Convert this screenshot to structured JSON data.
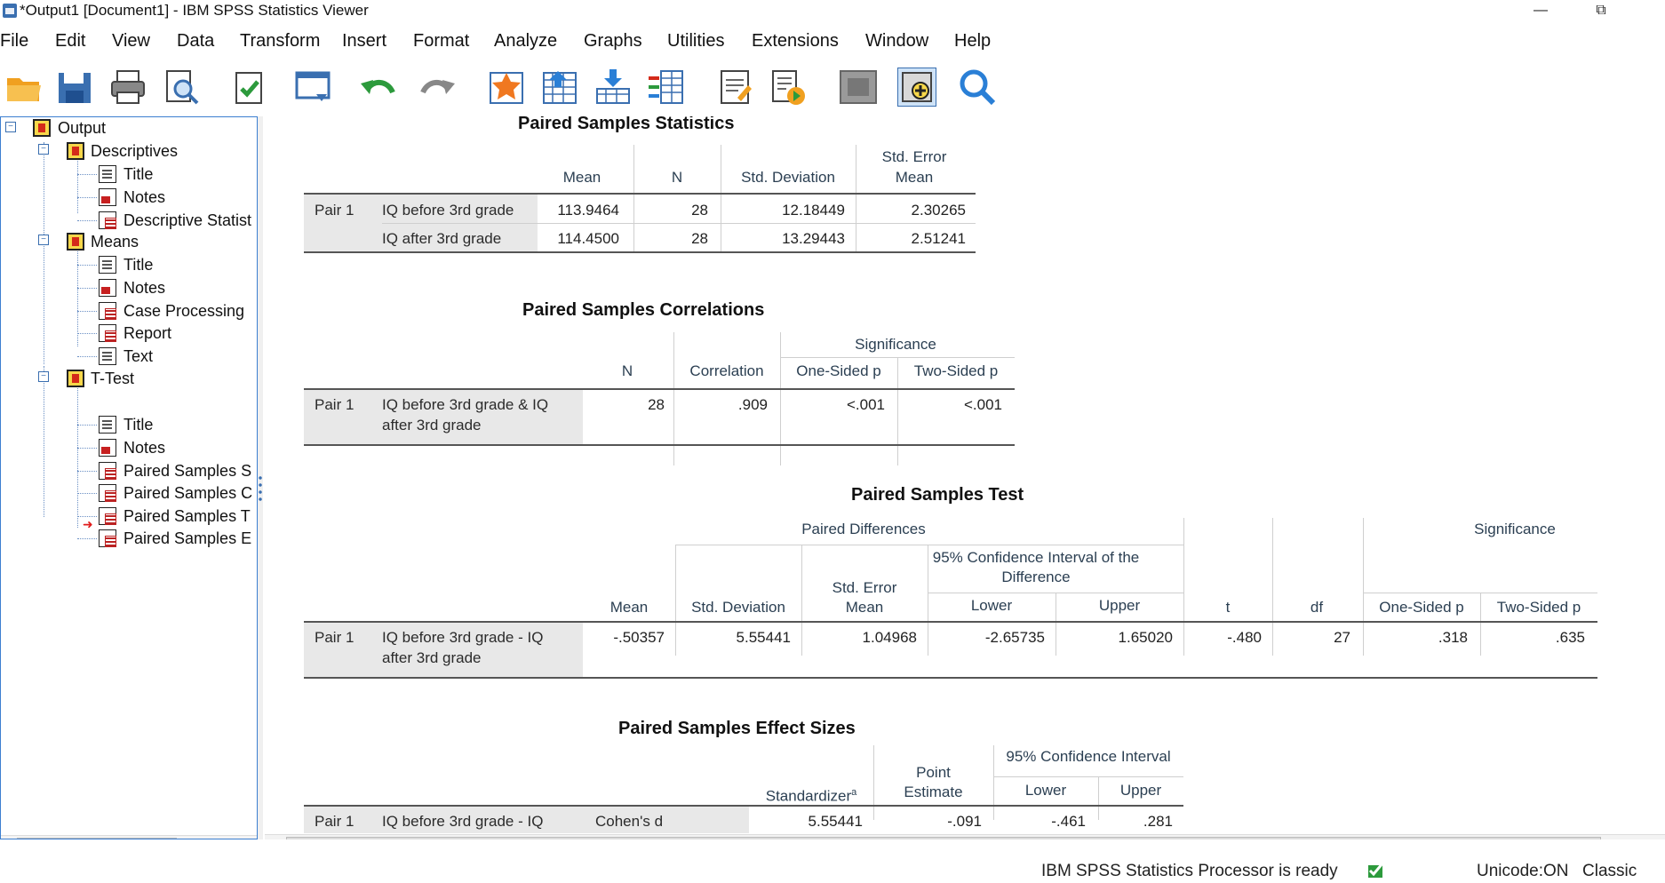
{
  "window": {
    "title": "*Output1 [Document1] - IBM SPSS Statistics Viewer",
    "minimize": "—",
    "restore": "⧉"
  },
  "menu": [
    "File",
    "Edit",
    "View",
    "Data",
    "Transform",
    "Insert",
    "Format",
    "Analyze",
    "Graphs",
    "Utilities",
    "Extensions",
    "Window",
    "Help"
  ],
  "toolbar": [
    "open-icon",
    "save-icon",
    "print-icon",
    "print-preview-icon",
    "export-icon",
    "recall-dialog-icon",
    "undo-icon",
    "redo-icon",
    "goto-case-icon",
    "goto-variable-icon",
    "variables-icon",
    "insert-output-icon",
    "designate-window-icon",
    "run-script-icon",
    "show-pane-icon",
    "add-item-icon",
    "search-icon"
  ],
  "outline": {
    "root": "Output",
    "descriptives": {
      "label": "Descriptives",
      "items": [
        "Title",
        "Notes",
        "Descriptive Statist"
      ]
    },
    "means": {
      "label": "Means",
      "items": [
        "Title",
        "Notes",
        "Case Processing",
        "Report",
        "Text"
      ]
    },
    "ttest": {
      "label": "T-Test",
      "items": [
        "Title",
        "Notes",
        "Paired Samples S",
        "Paired Samples C",
        "Paired Samples T",
        "Paired Samples E"
      ]
    }
  },
  "stats": {
    "title": "Paired Samples Statistics",
    "headers": [
      "Mean",
      "N",
      "Std. Deviation",
      "Std. Error",
      "Mean"
    ],
    "pair": "Pair 1",
    "rows": [
      [
        "IQ before 3rd grade",
        "113.9464",
        "28",
        "12.18449",
        "2.30265"
      ],
      [
        "IQ after 3rd grade",
        "114.4500",
        "28",
        "13.29443",
        "2.51241"
      ]
    ]
  },
  "corr": {
    "title": "Paired Samples Correlations",
    "significance": "Significance",
    "headers": [
      "N",
      "Correlation",
      "One-Sided p",
      "Two-Sided p"
    ],
    "pair": "Pair 1",
    "label1": "IQ before 3rd grade & IQ",
    "label2": "after 3rd grade",
    "values": [
      "28",
      ".909",
      "<.001",
      "<.001"
    ]
  },
  "test": {
    "title": "Paired Samples Test",
    "paired_diff": "Paired Differences",
    "ci1": "95% Confidence Interval of the",
    "ci2": "Difference",
    "significance": "Significance",
    "se1": "Std. Error",
    "se2": "Mean",
    "headers": [
      "Mean",
      "Std. Deviation",
      "Lower",
      "Upper",
      "t",
      "df",
      "One-Sided p",
      "Two-Sided p"
    ],
    "pair": "Pair 1",
    "label1": "IQ before 3rd grade - IQ",
    "label2": "after 3rd grade",
    "values": [
      "-.50357",
      "5.55441",
      "1.04968",
      "-2.65735",
      "1.65020",
      "-.480",
      "27",
      ".318",
      ".635"
    ]
  },
  "effect": {
    "title": "Paired Samples Effect Sizes",
    "standardizer": "Standardizer",
    "sup": "a",
    "point1": "Point",
    "point2": "Estimate",
    "ci": "95% Confidence Interval",
    "lower": "Lower",
    "upper": "Upper",
    "pair": "Pair 1",
    "label": "IQ before 3rd grade - IQ",
    "measure": "Cohen's d",
    "values": [
      "5.55441",
      "-.091",
      "-.461",
      ".281"
    ]
  },
  "status": {
    "processor": "IBM SPSS Statistics Processor is ready",
    "unicode": "Unicode:ON",
    "mode": "Classic"
  }
}
